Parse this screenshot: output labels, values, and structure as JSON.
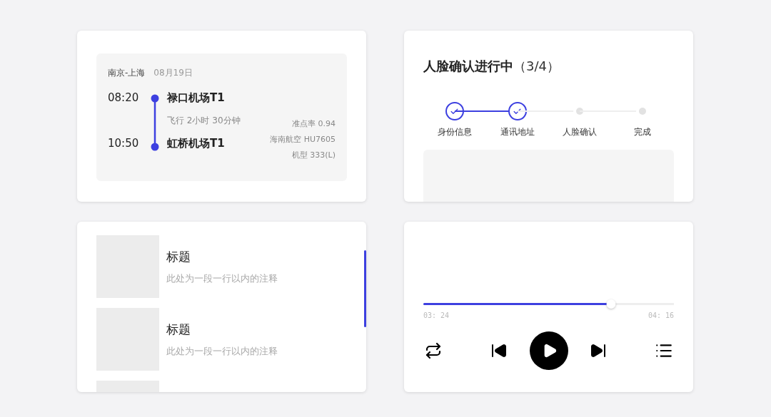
{
  "flight_card": {
    "route": "南京-上海",
    "date": "08月19日",
    "departure": {
      "time": "08:20",
      "airport": "禄口机场T1"
    },
    "duration": "飞行 2小时 30分钟",
    "arrival": {
      "time": "10:50",
      "airport": "虹桥机场T1"
    },
    "details": [
      "准点率 0.94",
      "海南航空 HU7605",
      "机型 333(L)"
    ]
  },
  "verification_card": {
    "title": "人脸确认进行中",
    "progress": "（3/4）",
    "steps": [
      {
        "label": "身份信息",
        "done": true
      },
      {
        "label": "通讯地址",
        "done": true
      },
      {
        "label": "人脸确认",
        "done": false
      },
      {
        "label": "完成",
        "done": false
      }
    ]
  },
  "list_card": {
    "items": [
      {
        "kind": "item",
        "title": "标题",
        "note": "此处为一段一行以内的注释"
      },
      {
        "kind": "item",
        "title": "标题",
        "note": "此处为一段一行以内的注释"
      },
      {
        "kind": "picture"
      }
    ]
  },
  "player": {
    "level": 0.75,
    "elapsed": "03: 24",
    "total": "04: 16",
    "playing": false
  }
}
